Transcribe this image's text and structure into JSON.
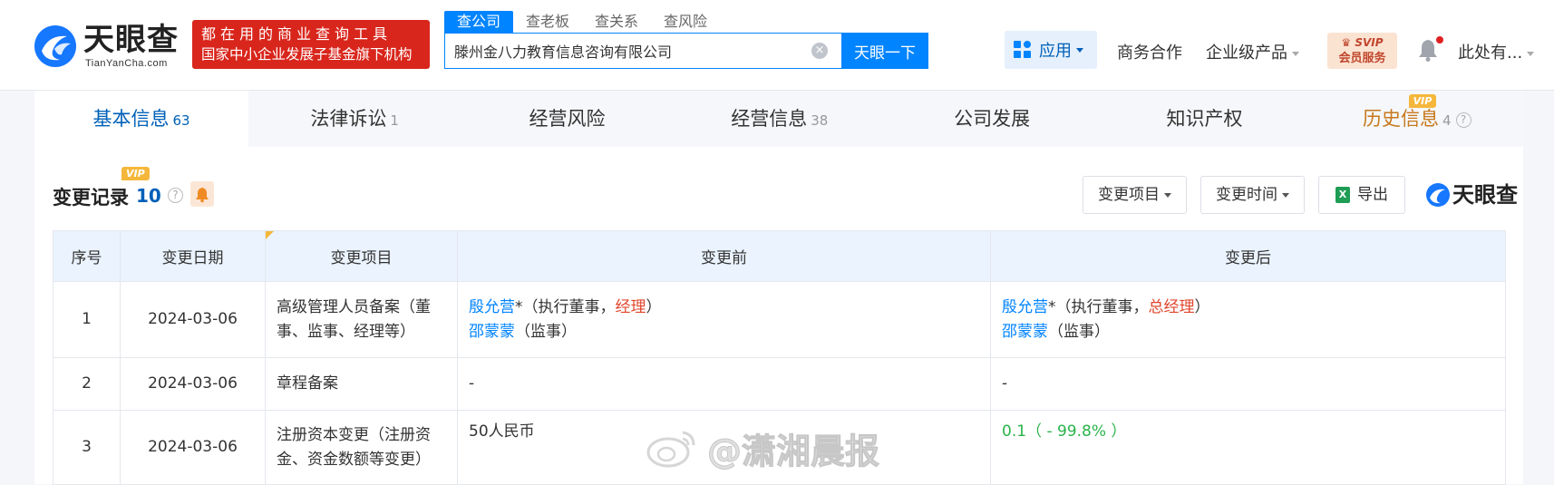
{
  "brand": {
    "name": "天眼查",
    "domain": "TianYanCha.com",
    "slogan_line1": "都在用的商业查询工具",
    "slogan_line2": "国家中小企业发展子基金旗下机构"
  },
  "search": {
    "tabs": [
      "查公司",
      "查老板",
      "查关系",
      "查风险"
    ],
    "value": "滕州金八力教育信息咨询有限公司",
    "button": "天眼一下"
  },
  "nav": {
    "app": "应用",
    "business": "商务合作",
    "enterprise": "企业级产品",
    "svip_line1": "SVIP",
    "svip_line2": "会员服务",
    "user": "此处有..."
  },
  "tabs": [
    {
      "label": "基本信息",
      "count": "63"
    },
    {
      "label": "法律诉讼",
      "count": "1"
    },
    {
      "label": "经营风险",
      "count": ""
    },
    {
      "label": "经营信息",
      "count": "38"
    },
    {
      "label": "公司发展",
      "count": ""
    },
    {
      "label": "知识产权",
      "count": ""
    },
    {
      "label": "历史信息",
      "count": "4"
    }
  ],
  "vip_label": "VIP",
  "section": {
    "title": "变更记录",
    "count": "10",
    "filter_item": "变更项目",
    "filter_time": "变更时间",
    "export": "导出",
    "brand": "天眼查"
  },
  "table": {
    "headers": [
      "序号",
      "变更日期",
      "变更项目",
      "变更前",
      "变更后"
    ],
    "rows": [
      {
        "no": "1",
        "date": "2024-03-06",
        "item": "高级管理人员备案（董事、监事、经理等）",
        "before_name1": "殷允营",
        "before_mid1": "*（执行董事，",
        "before_role1": "经理",
        "before_end1": "）",
        "before_name2": "邵蒙蒙",
        "before_role2": "（监事）",
        "after_name1": "殷允营",
        "after_mid1": "*（执行董事，",
        "after_role1": "总经理",
        "after_end1": "）",
        "after_name2": "邵蒙蒙",
        "after_role2": "（监事）"
      },
      {
        "no": "2",
        "date": "2024-03-06",
        "item": "章程备案",
        "before": "-",
        "after": "-"
      },
      {
        "no": "3",
        "date": "2024-03-06",
        "item": "注册资本变更（注册资金、资金数额等变更）",
        "before": "50人民币",
        "after": "0.1（ - 99.8% ）"
      }
    ]
  },
  "watermark": "@潇湘晨报",
  "colors": {
    "primary": "#0084ff",
    "slogan_bg": "#d9261c",
    "history": "#c8781c",
    "vip": "#f5b73b",
    "increase": "#e0452c",
    "decrease": "#2ab34a"
  }
}
